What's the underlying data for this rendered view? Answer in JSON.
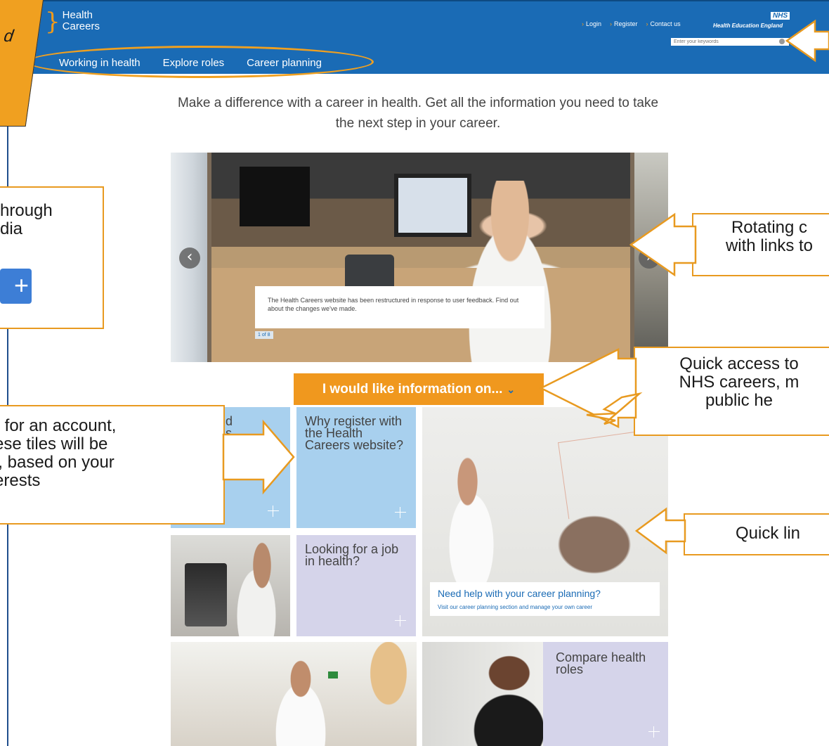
{
  "header": {
    "logo": {
      "line1": "Health",
      "line2": "Careers"
    },
    "nav": [
      "Working in health",
      "Explore roles",
      "Career planning"
    ],
    "util_links": [
      "Login",
      "Register",
      "Contact us"
    ],
    "nhs_badge": "NHS",
    "org_name": "Health Education England",
    "search_placeholder": "Enter your keywords"
  },
  "intro": "Make a difference with a career in health. Get all the information you need to take the next step in your career.",
  "carousel": {
    "caption": "The Health Careers website has been restructured in response to user feedback. Find out about the changes we've made.",
    "counter": "1 of 8",
    "prev_icon": "‹",
    "next_icon": "›"
  },
  "info_button": {
    "label": "I would like information on...",
    "chevron": "⌄"
  },
  "tiles": {
    "a_title": "d\ns",
    "b_title": "Why register with the Health Careers website?",
    "c_heading": "Need help with your career planning?",
    "c_sub": "Visit our career planning section and manage your own career",
    "e_title": "Looking for a job in health?",
    "g_title": "Compare health roles"
  },
  "callouts": {
    "top_left": "d",
    "social_line1": "hrough",
    "social_line2": "dia",
    "register_line1": "r for an account,",
    "register_line2": "ese tiles will be",
    "register_line3": "l, based on your",
    "register_line4": "erests",
    "rotating_line1": "Rotating c",
    "rotating_line2": "with links to",
    "quick_line1": "Quick access to",
    "quick_line2": "NHS careers, m",
    "quick_line3": "public he",
    "quick_links": "Quick lin"
  },
  "colors": {
    "header_bg": "#1a6bb5",
    "accent_orange": "#f0981e",
    "tile_blue": "#a8d0ee",
    "tile_lilac": "#d5d4ea"
  }
}
